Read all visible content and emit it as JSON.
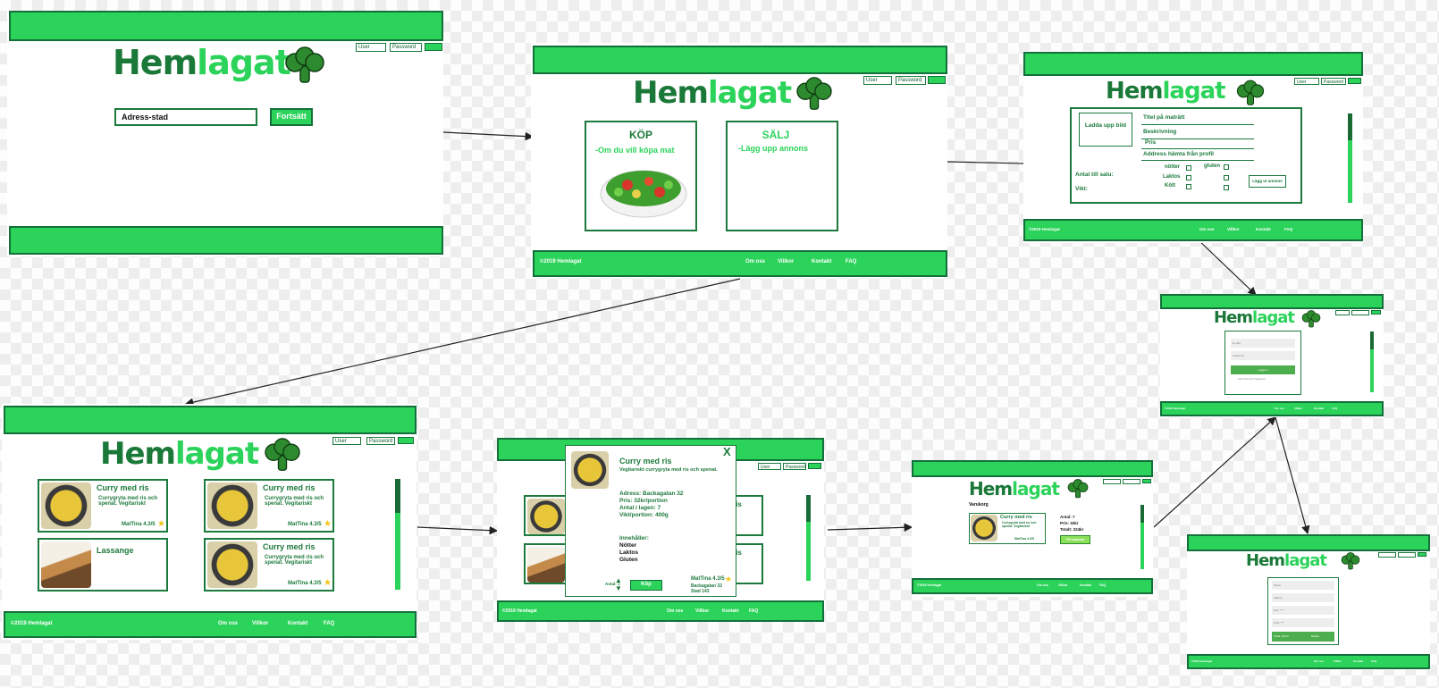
{
  "brand": {
    "part1": "Hem",
    "part2": "lagat",
    "logo_icon": "broccoli-icon"
  },
  "login": {
    "user": "User",
    "password": "Password"
  },
  "footer": {
    "copyright": "©2019 Hemlagat",
    "links": [
      "Om oss",
      "Villkor",
      "Kontakt",
      "FAQ"
    ]
  },
  "start": {
    "address_placeholder": "Adress-stad",
    "continue_button": "Fortsätt"
  },
  "choice": {
    "buy_title": "KÖP",
    "buy_text": "-Om du vill köpa mat",
    "sell_title": "SÄLJ",
    "sell_text": "-Lägg upp annons"
  },
  "sell_form": {
    "upload": "Ladda upp bild",
    "title_field": "Titel på maträtt",
    "description_field": "Beskrivning",
    "price_field": "Pris",
    "address_field": "Address hämta från profil",
    "quantity_label": "Antal till salu:",
    "weight_label": "Vikt:",
    "nuts": "nötter",
    "lactose": "Laktos",
    "meat": "Kött",
    "gluten": "gluten",
    "submit": "Lägg ut annons"
  },
  "listing": {
    "cards": [
      {
        "title": "Curry med ris",
        "desc": "Currygryta med ris och spenat. Vegitariskt",
        "seller": "MatTina 4.3/5"
      },
      {
        "title": "Curry med ris",
        "desc": "Currygryta med ris och spenat. Vegitariskt",
        "seller": "MatTina 4.3/5"
      },
      {
        "title": "Lassange",
        "desc": "",
        "seller": ""
      },
      {
        "title": "Curry med ris",
        "desc": "Currygryta med ris och spenat. Vegitariskt",
        "seller": "MatTina 4.3/5"
      }
    ]
  },
  "detail": {
    "close": "X",
    "title": "Curry med ris",
    "desc": "Vegitariskt currygryta med ris och spenat.",
    "address": "Adress: Backagatan 32",
    "price": "Pris: 32kr/portion",
    "stock": "Antal i lagen: 7",
    "weight": "Vikt/portion: 400g",
    "contains_label": "Innehåller:",
    "contains": [
      "Nötter",
      "Laktos",
      "Gluten"
    ],
    "qty": "Antal: 1",
    "buy": "Köp",
    "seller": "MatTina 4.3/5",
    "seller_address": "Backagatan 32",
    "seller_city": "Stad 143",
    "peek_titles": [
      "ris",
      "ris"
    ]
  },
  "cart": {
    "heading": "Varukorg",
    "item_title": "Curry med ris",
    "item_desc": "Currygryta med ris och spenat. Vegitariskt",
    "seller": "MatTina 4.3/5",
    "qty": "Antal: 7",
    "price": "Pris: 32kr",
    "total": "Totalt: 224kr",
    "checkout": "Till kassan"
  },
  "login_modal": {
    "email": "E-mail",
    "password": "Lösenord",
    "button": "Logga in",
    "link": "Glömt lösenord? Registrera"
  },
  "payment_modal": {
    "fields": [
      "Namn",
      "Adress",
      "Kort: ****",
      "CVC: ***"
    ],
    "total": "Totalt: 224 kr",
    "button": "Betala"
  }
}
